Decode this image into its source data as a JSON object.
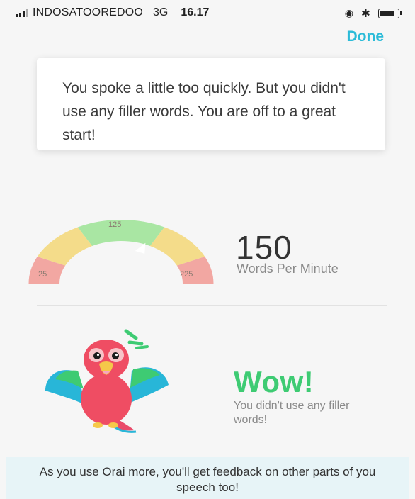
{
  "status_bar": {
    "carrier": "INDOSATOOREDOO",
    "network": "3G",
    "time": "16.17",
    "bluetooth_glyph": "∗",
    "alarm_glyph": "◉"
  },
  "header": {
    "done_label": "Done"
  },
  "feedback_card": {
    "text": "You spoke a little too quickly. But you didn't use any filler words. You are off to a great start!"
  },
  "gauge": {
    "min_label": "25",
    "mid_label": "125",
    "max_label": "225",
    "value": 150,
    "colors": {
      "low": "#f2a7a2",
      "mid_low": "#f4dc8a",
      "center": "#a9e6a3",
      "mid_high": "#f4dc8a",
      "high": "#f2a7a2"
    }
  },
  "speech_rate": {
    "value": "150",
    "unit_label": "Words Per Minute"
  },
  "filler": {
    "headline": "Wow!",
    "message": "You didn't use any filler words!"
  },
  "footer": {
    "text": "As you use Orai more, you'll get feedback on other parts of you speech too!"
  },
  "colors": {
    "accent": "#2bbbd8",
    "success": "#3ecb73",
    "footer_bg": "#e7f4f7"
  }
}
